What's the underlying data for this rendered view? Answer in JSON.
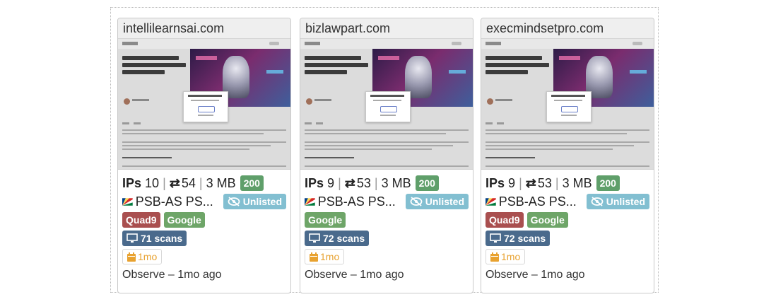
{
  "colors": {
    "status_green": "#5f9f6a",
    "unlisted_blue": "#82bfd1",
    "quad9_red": "#a94f4f",
    "google_green": "#6ea568",
    "scans_blue": "#4a6a8c",
    "age_orange": "#e8a230"
  },
  "thumbnail": {
    "heading": "Public Release of AI-Powered Money-Making Application"
  },
  "cards": [
    {
      "domain": "intellilearnsai.com",
      "ips_label": "IPs",
      "ips": "10",
      "transfers": "54",
      "size": "3 MB",
      "status": "200",
      "asn": "PSB-AS PS...",
      "unlisted_label": "Unlisted",
      "tags": [
        "Quad9",
        "Google"
      ],
      "scans": "71 scans",
      "age": "1mo",
      "observe": "Observe – 1mo ago"
    },
    {
      "domain": "bizlawpart.com",
      "ips_label": "IPs",
      "ips": "9",
      "transfers": "53",
      "size": "3 MB",
      "status": "200",
      "asn": "PSB-AS PS...",
      "unlisted_label": "Unlisted",
      "tags": [
        "Google"
      ],
      "scans": "72 scans",
      "age": "1mo",
      "observe": "Observe – 1mo ago"
    },
    {
      "domain": "execmindsetpro.com",
      "ips_label": "IPs",
      "ips": "9",
      "transfers": "53",
      "size": "3 MB",
      "status": "200",
      "asn": "PSB-AS PS...",
      "unlisted_label": "Unlisted",
      "tags": [
        "Quad9",
        "Google"
      ],
      "scans": "72 scans",
      "age": "1mo",
      "observe": "Observe – 1mo ago"
    }
  ]
}
